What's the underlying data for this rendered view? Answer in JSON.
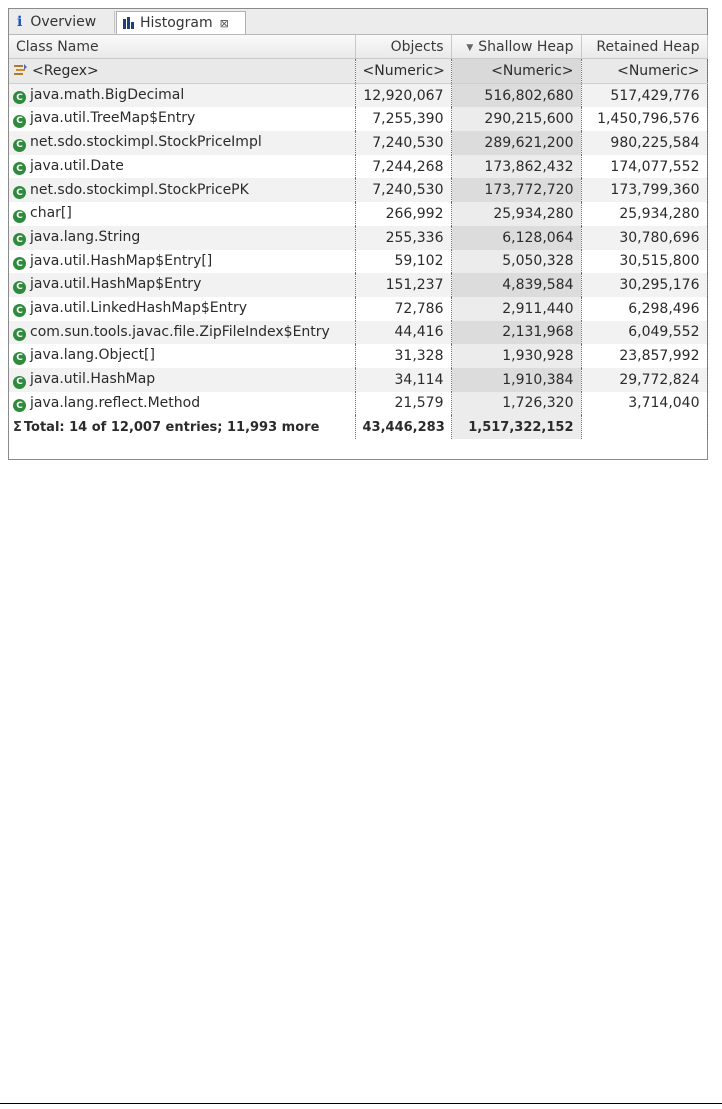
{
  "tabs": {
    "overview": {
      "label": "Overview",
      "icon": "info-icon"
    },
    "histogram": {
      "label": "Histogram",
      "icon": "histogram-icon",
      "close_symbol": "⊠"
    }
  },
  "columns": {
    "class_name": "Class Name",
    "objects": "Objects",
    "shallow_heap": "Shallow Heap",
    "retained_heap": "Retained Heap",
    "sorted_by": "shallow_heap",
    "sort_direction": "descending"
  },
  "filter_row": {
    "class_name": "<Regex>",
    "objects": "<Numeric>",
    "shallow_heap": "<Numeric>",
    "retained_heap": "<Numeric>"
  },
  "rows": [
    {
      "class_name": "java.math.BigDecimal",
      "objects": "12,920,067",
      "shallow_heap": "516,802,680",
      "retained_heap": "517,429,776"
    },
    {
      "class_name": "java.util.TreeMap$Entry",
      "objects": "7,255,390",
      "shallow_heap": "290,215,600",
      "retained_heap": "1,450,796,576"
    },
    {
      "class_name": "net.sdo.stockimpl.StockPriceImpl",
      "objects": "7,240,530",
      "shallow_heap": "289,621,200",
      "retained_heap": "980,225,584"
    },
    {
      "class_name": "java.util.Date",
      "objects": "7,244,268",
      "shallow_heap": "173,862,432",
      "retained_heap": "174,077,552"
    },
    {
      "class_name": "net.sdo.stockimpl.StockPricePK",
      "objects": "7,240,530",
      "shallow_heap": "173,772,720",
      "retained_heap": "173,799,360"
    },
    {
      "class_name": "char[]",
      "objects": "266,992",
      "shallow_heap": "25,934,280",
      "retained_heap": "25,934,280"
    },
    {
      "class_name": "java.lang.String",
      "objects": "255,336",
      "shallow_heap": "6,128,064",
      "retained_heap": "30,780,696"
    },
    {
      "class_name": "java.util.HashMap$Entry[]",
      "objects": "59,102",
      "shallow_heap": "5,050,328",
      "retained_heap": "30,515,800"
    },
    {
      "class_name": "java.util.HashMap$Entry",
      "objects": "151,237",
      "shallow_heap": "4,839,584",
      "retained_heap": "30,295,176"
    },
    {
      "class_name": "java.util.LinkedHashMap$Entry",
      "objects": "72,786",
      "shallow_heap": "2,911,440",
      "retained_heap": "6,298,496"
    },
    {
      "class_name": "com.sun.tools.javac.file.ZipFileIndex$Entry",
      "objects": "44,416",
      "shallow_heap": "2,131,968",
      "retained_heap": "6,049,552"
    },
    {
      "class_name": "java.lang.Object[]",
      "objects": "31,328",
      "shallow_heap": "1,930,928",
      "retained_heap": "23,857,992"
    },
    {
      "class_name": "java.util.HashMap",
      "objects": "34,114",
      "shallow_heap": "1,910,384",
      "retained_heap": "29,772,824"
    },
    {
      "class_name": "java.lang.reflect.Method",
      "objects": "21,579",
      "shallow_heap": "1,726,320",
      "retained_heap": "3,714,040"
    }
  ],
  "class_icon_letter": "C",
  "total_row": {
    "icon": "sum-icon",
    "symbol": "Σ",
    "label": "Total: 14 of 12,007 entries; 11,993 more",
    "objects": "43,446,283",
    "shallow_heap": "1,517,322,152",
    "retained_heap": ""
  },
  "colors": {
    "class_icon": "#2e8b3b",
    "sorted_column_bg": "#ececec",
    "info_icon": "#1a52b8"
  }
}
